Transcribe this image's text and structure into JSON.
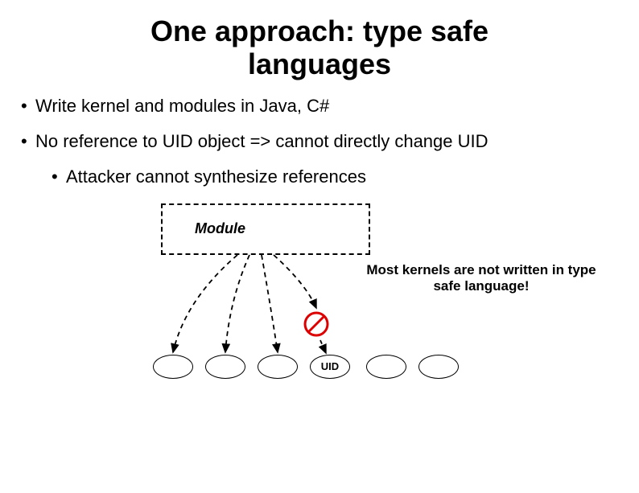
{
  "title_line1": "One approach: type safe",
  "title_line2": "languages",
  "bullets": {
    "b1a": "Write kernel and modules in Java, C#",
    "b1b": "No reference to UID object => cannot directly change UID",
    "b2a": "Attacker cannot synthesize references"
  },
  "diagram": {
    "module_label": "Module",
    "annotation": "Most kernels are not written in type safe language!",
    "uid_label": "UID"
  }
}
